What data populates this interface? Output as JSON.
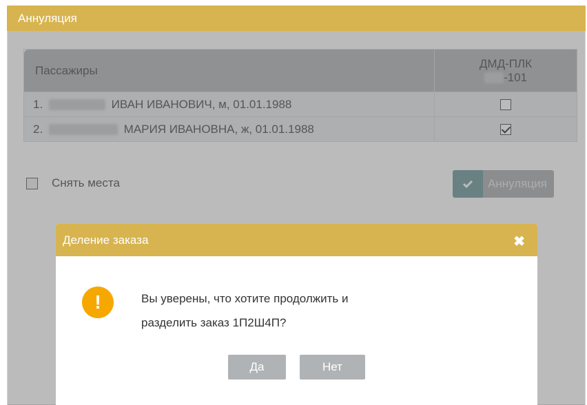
{
  "panel": {
    "title": "Аннуляция"
  },
  "table": {
    "col_passengers": "Пассажиры",
    "col_train_line1": "ДМД-ПЛК",
    "col_train_line2": "-101",
    "rows": [
      {
        "num": "1.",
        "name": "ИВАН ИВАНОВИЧ, м, 01.01.1988",
        "checked": false
      },
      {
        "num": "2.",
        "name": "МАРИЯ ИВАНОВНА, ж, 01.01.1988",
        "checked": true
      }
    ]
  },
  "remove_seats": {
    "label": "Снять места",
    "checked": false
  },
  "annul_button": {
    "label": "Аннуляция",
    "icon": "check-icon"
  },
  "dialog": {
    "title": "Деление заказа",
    "close_icon": "close-icon",
    "warning_icon": "exclamation-icon",
    "warning_glyph": "!",
    "message_line1": "Вы уверены, что хотите продолжить и",
    "message_line2": "разделить заказ 1П2Ш4П?",
    "yes_label": "Да",
    "no_label": "Нет"
  },
  "colors": {
    "header": "#d7b44f",
    "warning": "#f6a800",
    "button_accent": "#5a8b8e"
  }
}
